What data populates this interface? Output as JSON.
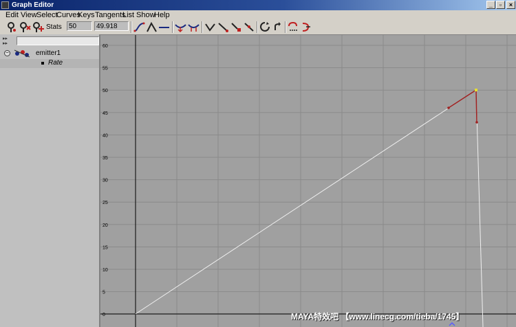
{
  "window": {
    "title": "Graph Editor"
  },
  "menu": [
    "Edit",
    "View",
    "Select",
    "Curves",
    "Keys",
    "Tangents",
    "List",
    "Show",
    "Help"
  ],
  "toolbar": {
    "stats_label": "Stats",
    "frame_value": "50",
    "key_value": "49.918",
    "icons": [
      "move-keys-icon",
      "insert-keys-icon",
      "add-keys-icon",
      "spline-tangent-icon",
      "clamped-tangent-icon",
      "linear-tangent-icon",
      "break-tangents-icon",
      "unify-tangents-icon",
      "flat-tangent-icon",
      "step-tangent-icon",
      "plateau-tangent-icon",
      "fixed-tangent-icon",
      "cycle-infinity-icon",
      "cycle-offset-icon",
      "pre-infinity-icon",
      "post-infinity-icon"
    ]
  },
  "outliner": {
    "node_label": "emitter1",
    "attribute_label": "Rate"
  },
  "graph": {
    "y_ticks": [
      "60",
      "55",
      "50",
      "45",
      "40",
      "35",
      "30",
      "25",
      "20",
      "15",
      "10",
      "5",
      "0"
    ],
    "curve_color": "#f0f0f0",
    "selected_key_color": "#e8e030",
    "tangent_color": "#a02020",
    "background": "#a0a0a0"
  },
  "watermark": "MAYA特效吧  【www.linecg.com/tieba/1745】"
}
